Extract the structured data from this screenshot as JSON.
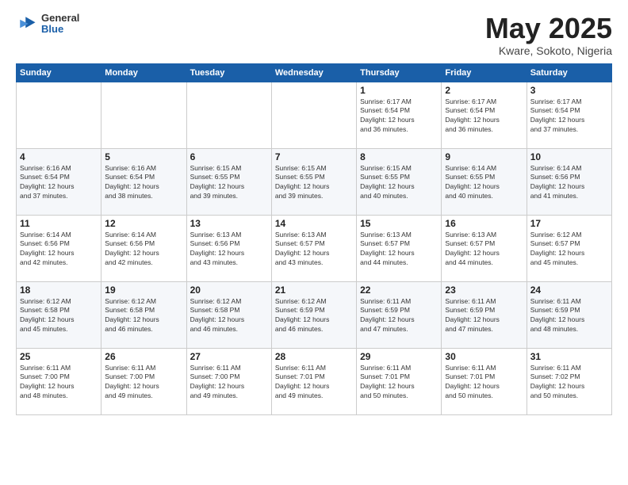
{
  "logo": {
    "general": "General",
    "blue": "Blue"
  },
  "title": "May 2025",
  "subtitle": "Kware, Sokoto, Nigeria",
  "weekdays": [
    "Sunday",
    "Monday",
    "Tuesday",
    "Wednesday",
    "Thursday",
    "Friday",
    "Saturday"
  ],
  "weeks": [
    [
      {
        "day": "",
        "info": ""
      },
      {
        "day": "",
        "info": ""
      },
      {
        "day": "",
        "info": ""
      },
      {
        "day": "",
        "info": ""
      },
      {
        "day": "1",
        "info": "Sunrise: 6:17 AM\nSunset: 6:54 PM\nDaylight: 12 hours\nand 36 minutes."
      },
      {
        "day": "2",
        "info": "Sunrise: 6:17 AM\nSunset: 6:54 PM\nDaylight: 12 hours\nand 36 minutes."
      },
      {
        "day": "3",
        "info": "Sunrise: 6:17 AM\nSunset: 6:54 PM\nDaylight: 12 hours\nand 37 minutes."
      }
    ],
    [
      {
        "day": "4",
        "info": "Sunrise: 6:16 AM\nSunset: 6:54 PM\nDaylight: 12 hours\nand 37 minutes."
      },
      {
        "day": "5",
        "info": "Sunrise: 6:16 AM\nSunset: 6:54 PM\nDaylight: 12 hours\nand 38 minutes."
      },
      {
        "day": "6",
        "info": "Sunrise: 6:15 AM\nSunset: 6:55 PM\nDaylight: 12 hours\nand 39 minutes."
      },
      {
        "day": "7",
        "info": "Sunrise: 6:15 AM\nSunset: 6:55 PM\nDaylight: 12 hours\nand 39 minutes."
      },
      {
        "day": "8",
        "info": "Sunrise: 6:15 AM\nSunset: 6:55 PM\nDaylight: 12 hours\nand 40 minutes."
      },
      {
        "day": "9",
        "info": "Sunrise: 6:14 AM\nSunset: 6:55 PM\nDaylight: 12 hours\nand 40 minutes."
      },
      {
        "day": "10",
        "info": "Sunrise: 6:14 AM\nSunset: 6:56 PM\nDaylight: 12 hours\nand 41 minutes."
      }
    ],
    [
      {
        "day": "11",
        "info": "Sunrise: 6:14 AM\nSunset: 6:56 PM\nDaylight: 12 hours\nand 42 minutes."
      },
      {
        "day": "12",
        "info": "Sunrise: 6:14 AM\nSunset: 6:56 PM\nDaylight: 12 hours\nand 42 minutes."
      },
      {
        "day": "13",
        "info": "Sunrise: 6:13 AM\nSunset: 6:56 PM\nDaylight: 12 hours\nand 43 minutes."
      },
      {
        "day": "14",
        "info": "Sunrise: 6:13 AM\nSunset: 6:57 PM\nDaylight: 12 hours\nand 43 minutes."
      },
      {
        "day": "15",
        "info": "Sunrise: 6:13 AM\nSunset: 6:57 PM\nDaylight: 12 hours\nand 44 minutes."
      },
      {
        "day": "16",
        "info": "Sunrise: 6:13 AM\nSunset: 6:57 PM\nDaylight: 12 hours\nand 44 minutes."
      },
      {
        "day": "17",
        "info": "Sunrise: 6:12 AM\nSunset: 6:57 PM\nDaylight: 12 hours\nand 45 minutes."
      }
    ],
    [
      {
        "day": "18",
        "info": "Sunrise: 6:12 AM\nSunset: 6:58 PM\nDaylight: 12 hours\nand 45 minutes."
      },
      {
        "day": "19",
        "info": "Sunrise: 6:12 AM\nSunset: 6:58 PM\nDaylight: 12 hours\nand 46 minutes."
      },
      {
        "day": "20",
        "info": "Sunrise: 6:12 AM\nSunset: 6:58 PM\nDaylight: 12 hours\nand 46 minutes."
      },
      {
        "day": "21",
        "info": "Sunrise: 6:12 AM\nSunset: 6:59 PM\nDaylight: 12 hours\nand 46 minutes."
      },
      {
        "day": "22",
        "info": "Sunrise: 6:11 AM\nSunset: 6:59 PM\nDaylight: 12 hours\nand 47 minutes."
      },
      {
        "day": "23",
        "info": "Sunrise: 6:11 AM\nSunset: 6:59 PM\nDaylight: 12 hours\nand 47 minutes."
      },
      {
        "day": "24",
        "info": "Sunrise: 6:11 AM\nSunset: 6:59 PM\nDaylight: 12 hours\nand 48 minutes."
      }
    ],
    [
      {
        "day": "25",
        "info": "Sunrise: 6:11 AM\nSunset: 7:00 PM\nDaylight: 12 hours\nand 48 minutes."
      },
      {
        "day": "26",
        "info": "Sunrise: 6:11 AM\nSunset: 7:00 PM\nDaylight: 12 hours\nand 49 minutes."
      },
      {
        "day": "27",
        "info": "Sunrise: 6:11 AM\nSunset: 7:00 PM\nDaylight: 12 hours\nand 49 minutes."
      },
      {
        "day": "28",
        "info": "Sunrise: 6:11 AM\nSunset: 7:01 PM\nDaylight: 12 hours\nand 49 minutes."
      },
      {
        "day": "29",
        "info": "Sunrise: 6:11 AM\nSunset: 7:01 PM\nDaylight: 12 hours\nand 50 minutes."
      },
      {
        "day": "30",
        "info": "Sunrise: 6:11 AM\nSunset: 7:01 PM\nDaylight: 12 hours\nand 50 minutes."
      },
      {
        "day": "31",
        "info": "Sunrise: 6:11 AM\nSunset: 7:02 PM\nDaylight: 12 hours\nand 50 minutes."
      }
    ]
  ]
}
